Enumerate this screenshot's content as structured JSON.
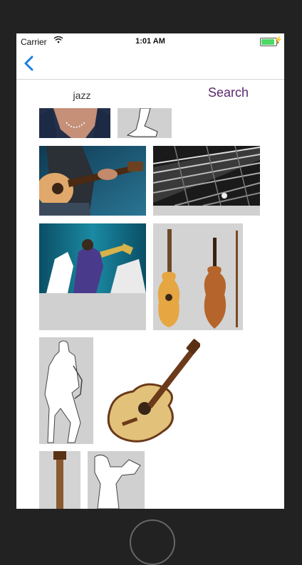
{
  "status_bar": {
    "carrier": "Carrier",
    "time": "1:01 AM",
    "battery_level": 0.9
  },
  "nav": {
    "back_icon": "chevron-left-icon"
  },
  "search": {
    "query": "jazz",
    "button_label": "Search"
  },
  "results": [
    {
      "name": "jazz-singer-photo"
    },
    {
      "name": "saxophone-silhouette-top"
    },
    {
      "name": "guitar-player-photo"
    },
    {
      "name": "guitar-strings-bw-photo"
    },
    {
      "name": "jazz-band-photo"
    },
    {
      "name": "guitar-and-violin-photo"
    },
    {
      "name": "saxophone-player-silhouette"
    },
    {
      "name": "acoustic-guitar-photo"
    },
    {
      "name": "guitar-neck-photo"
    },
    {
      "name": "trumpet-player-silhouette"
    }
  ],
  "colors": {
    "accent": "#1a7fe0",
    "search_button": "#5a2a6e",
    "placeholder_tile": "#d0d0d0",
    "frame": "#222222"
  }
}
